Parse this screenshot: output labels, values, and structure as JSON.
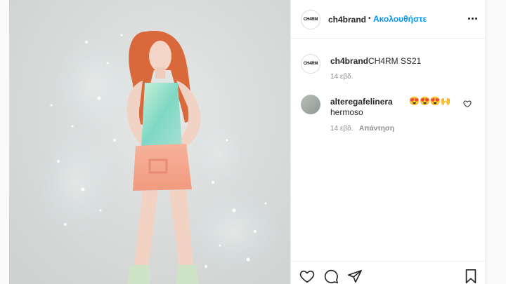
{
  "post": {
    "username": "ch4brand",
    "avatar_text": "CH4RM",
    "follow_label": "Ακολουθήστε",
    "separator": "•",
    "caption": "CH4RM SS21",
    "caption_time": "14 εβδ."
  },
  "comment": {
    "username": "alteregafelinera",
    "emoji": "😍😍😍🙌",
    "text": "hermoso",
    "time": "14 εβδ.",
    "reply_label": "Απάντηση"
  },
  "icons": [
    "more-icon",
    "heart-icon",
    "comment-icon",
    "share-icon",
    "bookmark-icon",
    "like-comment-icon"
  ],
  "colors": {
    "accent": "#0095f6",
    "text": "#262626",
    "meta": "#8e8e8e"
  }
}
